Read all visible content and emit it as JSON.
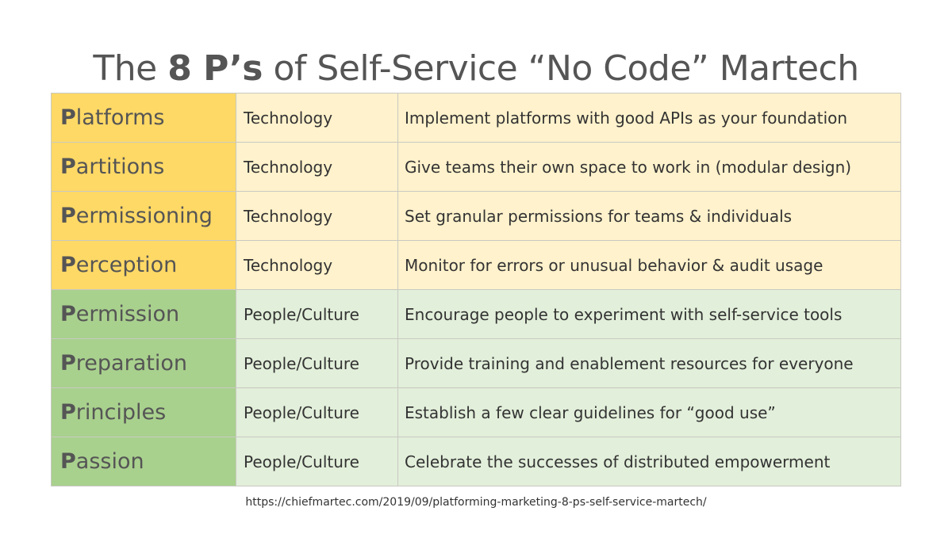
{
  "title": {
    "prefix": "The ",
    "bold": "8 P’s",
    "suffix": " of Self-Service “No Code” Martech"
  },
  "colors": {
    "technology_primary": "#ffd966",
    "technology_light": "#fff2cc",
    "people_primary": "#a9d18e",
    "people_light": "#e2efda",
    "border": "#c9c9c2",
    "title_text": "#555555"
  },
  "rows": [
    {
      "initial": "P",
      "rest": "latforms",
      "category": "Technology",
      "description": "Implement platforms with good APIs as your foundation",
      "group": "tech"
    },
    {
      "initial": "P",
      "rest": "artitions",
      "category": "Technology",
      "description": "Give teams their own space to work in (modular design)",
      "group": "tech"
    },
    {
      "initial": "P",
      "rest": "ermissioning",
      "category": "Technology",
      "description": "Set granular permissions for teams & individuals",
      "group": "tech"
    },
    {
      "initial": "P",
      "rest": "erception",
      "category": "Technology",
      "description": "Monitor for errors or unusual behavior & audit usage",
      "group": "tech"
    },
    {
      "initial": "P",
      "rest": "ermission",
      "category": "People/Culture",
      "description": "Encourage people to experiment with self-service tools",
      "group": "people"
    },
    {
      "initial": "P",
      "rest": "reparation",
      "category": "People/Culture",
      "description": "Provide training and enablement resources for everyone",
      "group": "people"
    },
    {
      "initial": "P",
      "rest": "rinciples",
      "category": "People/Culture",
      "description": "Establish a few clear guidelines for “good use”",
      "group": "people"
    },
    {
      "initial": "P",
      "rest": "assion",
      "category": "People/Culture",
      "description": "Celebrate the successes of distributed empowerment",
      "group": "people"
    }
  ],
  "source_url": "https://chiefmartec.com/2019/09/platforming-marketing-8-ps-self-service-martech/"
}
